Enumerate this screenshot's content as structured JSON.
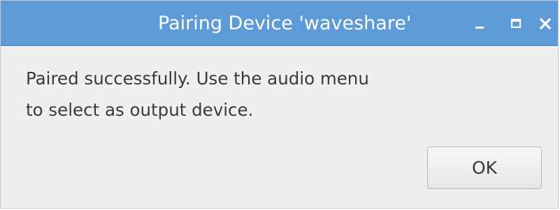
{
  "window": {
    "title": "Pairing Device 'waveshare'",
    "controls": {
      "minimize": "minimize-icon",
      "maximize": "maximize-icon",
      "close": "close-icon"
    },
    "colors": {
      "titlebar": "#5d9ad8",
      "background": "#efefef",
      "text": "#3a3a3a"
    }
  },
  "dialog": {
    "message_line1": "Paired successfully. Use the audio menu",
    "message_line2": "to select as output device.",
    "ok_label": "OK"
  }
}
